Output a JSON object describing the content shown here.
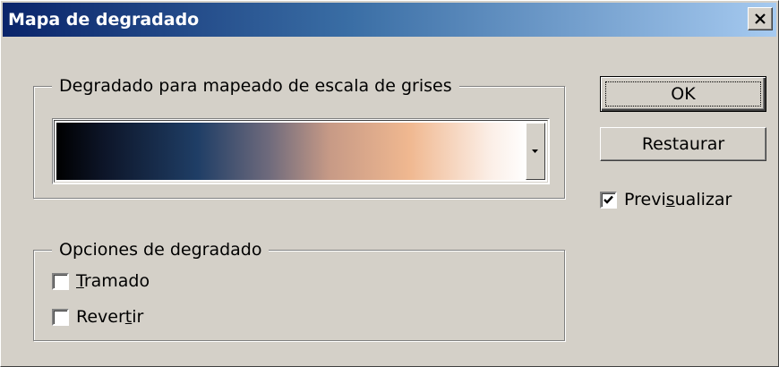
{
  "window": {
    "title": "Mapa de degradado"
  },
  "gradient_group": {
    "legend": "Degradado para mapeado de escala de grises",
    "gradient_colors": [
      "#000000",
      "#1f3e66",
      "#c79a86",
      "#f0b890",
      "#ffffff"
    ]
  },
  "options_group": {
    "legend": "Opciones de degradado",
    "dither": {
      "label_pre": "",
      "label_u": "T",
      "label_post": "ramado",
      "checked": false
    },
    "reverse": {
      "label_pre": "Rever",
      "label_u": "t",
      "label_post": "ir",
      "checked": false
    }
  },
  "buttons": {
    "ok": "OK",
    "reset": "Restaurar"
  },
  "preview": {
    "label_pre": "Previ",
    "label_u": "s",
    "label_post": "ualizar",
    "checked": true
  },
  "icons": {
    "close": "close-icon",
    "dropdown": "chevron-down-icon",
    "check": "check-icon"
  }
}
